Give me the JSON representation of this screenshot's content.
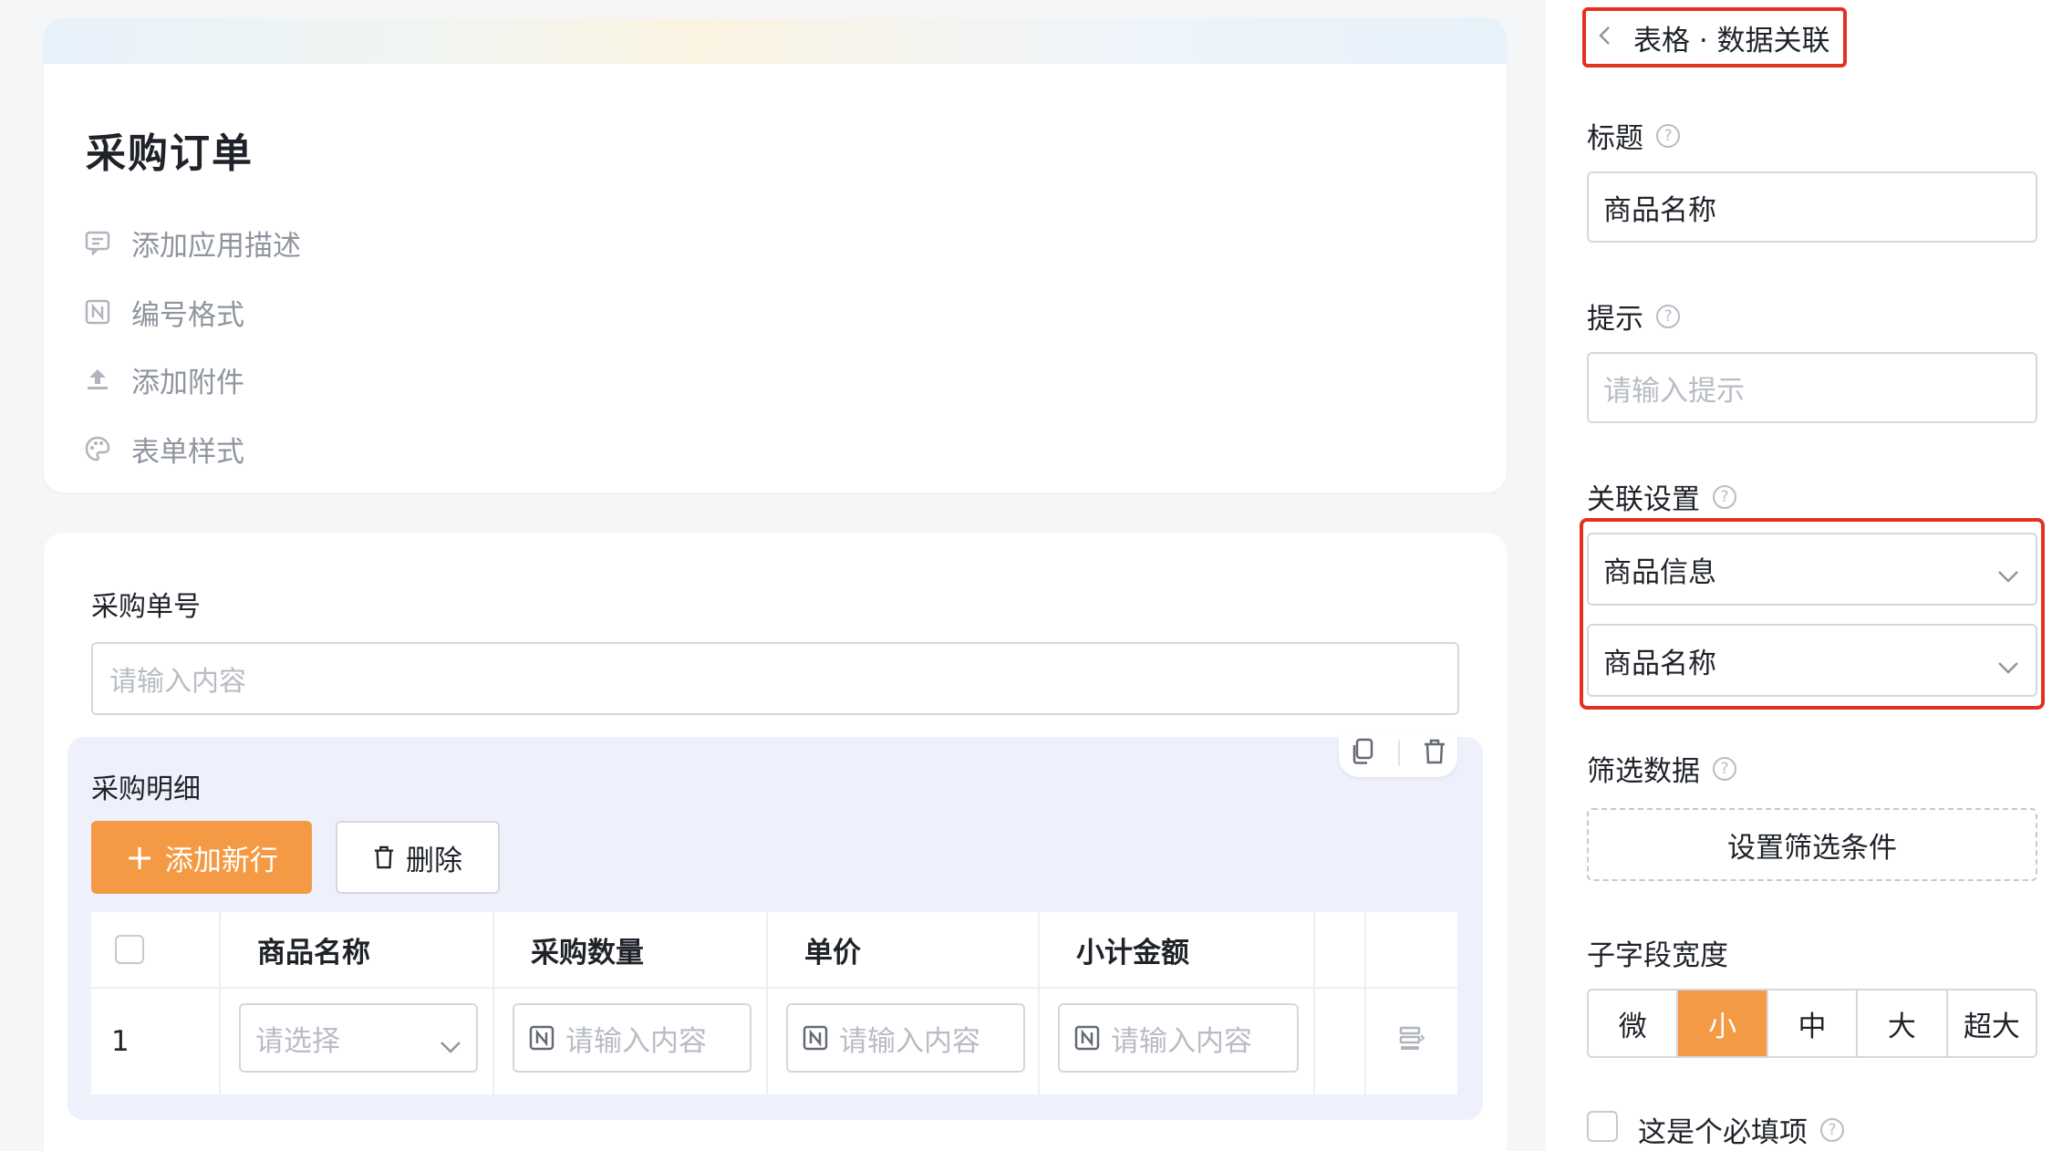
{
  "form": {
    "title": "采购订单",
    "header_items": [
      {
        "label": "添加应用描述",
        "icon": "comment-icon"
      },
      {
        "label": "编号格式",
        "icon": "number-format-icon"
      },
      {
        "label": "添加附件",
        "icon": "upload-icon"
      },
      {
        "label": "表单样式",
        "icon": "palette-icon"
      }
    ],
    "order_no": {
      "label": "采购单号",
      "placeholder": "请输入内容"
    },
    "detail": {
      "label": "采购明细",
      "add_button": "添加新行",
      "delete_button": "删除",
      "columns": [
        "商品名称",
        "采购数量",
        "单价",
        "小计金额"
      ],
      "rows": [
        {
          "index": "1",
          "product_placeholder": "请选择",
          "qty_placeholder": "请输入内容",
          "price_placeholder": "请输入内容",
          "subtotal_placeholder": "请输入内容"
        }
      ]
    }
  },
  "panel": {
    "breadcrumb": "表格 · 数据关联",
    "title_label": "标题",
    "title_value": "商品名称",
    "hint_label": "提示",
    "hint_placeholder": "请输入提示",
    "relation_label": "关联设置",
    "relation_source": "商品信息",
    "relation_field": "商品名称",
    "filter_label": "筛选数据",
    "filter_button": "设置筛选条件",
    "width_label": "子字段宽度",
    "width_options": [
      "微",
      "小",
      "中",
      "大",
      "超大"
    ],
    "width_selected": "小",
    "required_label": "这是个必填项"
  },
  "colors": {
    "accent": "#f59a44",
    "highlight_border": "#e2321f"
  }
}
